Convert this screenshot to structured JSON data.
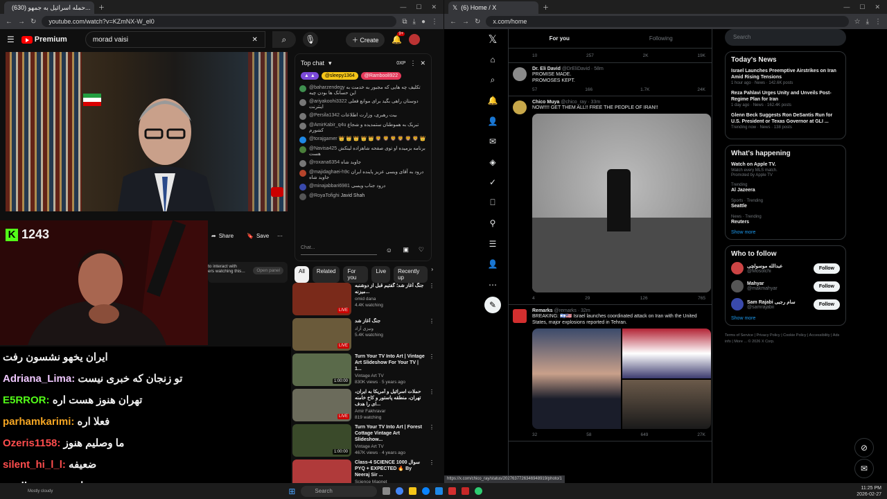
{
  "yt": {
    "tab_title": "(630) حمله اسرائیل به جمهو...",
    "url": "youtube.com/watch?v=KZmNX-W_el0",
    "logo": "Premium",
    "search": "morad vaisi",
    "create": "Create",
    "notif_count": "9+",
    "share": "Share",
    "save": "Save",
    "sign_in_text": "to interact with",
    "sign_in_text2": "ers watching this...",
    "open_panel": "Open panel",
    "livechat": {
      "title": "Top chat",
      "xp": "0XP",
      "pills": [
        "@sleepy1364",
        "@Rambooli922"
      ],
      "messages": [
        {
          "user": "@baharzendegy",
          "text": "تکلیف چه هایی که مجبور به خدمت به این حسانک ها بودن چیه",
          "color": "#3f8f4f"
        },
        {
          "user": "@ariyakoohi3322",
          "text": "دوستان راهی بگید برای موانع فعلی اینترنت",
          "color": "#777"
        },
        {
          "user": "@Persila1342",
          "text": "بیت رهبری، وزارت اطلاعات",
          "color": "#777"
        },
        {
          "user": "@AmirKabir_q4u",
          "text": "تبریک به هموطنان ستمدیده و شجاع کشورم",
          "color": "#777"
        },
        {
          "user": "@torajgamer",
          "text": "👑 👑 👑 👑 👑 🦁 🦁 🦁 🦁 🦁 🦁 👑",
          "color": "#1e88e5"
        },
        {
          "user": "@Navisa425",
          "text": "برنامه بزمیده او توی صفحه شاهزاده لینکش هست",
          "color": "#4a7f3a"
        },
        {
          "user": "@roxana6354",
          "text": "جاوید شاه",
          "color": "#777"
        },
        {
          "user": "@majidaghaei-h9c",
          "text": "درود به آقای ویسی عزیز پاینده ایران جاوید شاه",
          "color": "#b5442b"
        },
        {
          "user": "@minajabbari6981",
          "text": "درود جناب ویسی",
          "color": "#3949ab"
        },
        {
          "user": "@RoyaTofighi",
          "text": "Javid Shah",
          "color": "#555"
        }
      ],
      "input": "Chat..."
    },
    "filters": [
      "All",
      "Related",
      "For you",
      "Live",
      "Recently up"
    ],
    "recs": [
      {
        "title": "جنگ آغاز شد؛ گفتیم قبل از دوشنبه میزنه...",
        "channel": "omid dana",
        "meta": "4.4K watching",
        "badge": "LIVE",
        "thumb": "#7a2a1a"
      },
      {
        "title": "جنگ آغاز شد",
        "channel": "ونیزی آزاد",
        "meta": "5.4K watching",
        "badge": "LIVE",
        "thumb": "#6a5a3a"
      },
      {
        "title": "Turn Your TV Into Art | Vintage Art Slideshow For Your TV | 1...",
        "channel": "Vintage Art TV",
        "meta": "830K views · 5 years ago",
        "badge": "1:00:00",
        "thumb": "#5a6a4a"
      },
      {
        "title": "حملات اسرائیل و آمریکا به ایران، تهران، منطقه پاستور و کاخ خامنه ای را هدف...",
        "channel": "Amir Fakhravar",
        "meta": "819 watching",
        "badge": "LIVE",
        "thumb": "#6b6b5b"
      },
      {
        "title": "Turn Your TV Into Art | Forest Cottage Vintage Art Slideshow...",
        "channel": "Vintage Art TV",
        "meta": "467K views · 4 years ago",
        "badge": "1:00:00",
        "thumb": "#3a4a2a"
      },
      {
        "title": "Class-4 SCIENCE 1000 سوال PYQ + EXPECTED 🔥 By Neeraj Sir ...",
        "channel": "Science Magnet",
        "meta": "",
        "badge": "",
        "thumb": "#b03a3a"
      }
    ]
  },
  "stream": {
    "viewers": "1243",
    "chat": [
      {
        "user": "",
        "text": "ایران یخهو نشسون رفت",
        "color": "#ffffff"
      },
      {
        "user": "Adriana_Lima:",
        "text": "تو زنجان که خبری نیست",
        "color": "#f0c8ff"
      },
      {
        "user": "E5RROR:",
        "text": "تهران هنوز هست اره",
        "color": "#53fc18"
      },
      {
        "user": "parhamkarimi:",
        "text": "فعلا اره",
        "color": "#f5a623"
      },
      {
        "user": "Ozeris1158:",
        "text": "ما وصلیم هنوز",
        "color": "#ff4d4d"
      },
      {
        "user": "silent_hi_l_l:",
        "text": "ضعیفه",
        "color": "#ff4d4d"
      },
      {
        "user": "madbery:",
        "text": "ضعیفه اینترنت",
        "color": "#ffffff"
      }
    ]
  },
  "x": {
    "tab_title": "(6) Home / X",
    "url": "x.com/home",
    "tabs": [
      "For you",
      "Following"
    ],
    "tweets": [
      {
        "name": "Dr. Eli David",
        "handle": "@DrEliDavid · 58m",
        "text": "PROMISE MADE.\nPROMOSES KEPT.",
        "stats": [
          "57",
          "166",
          "1.7K",
          "24K"
        ],
        "avatar": "#8a8a8a"
      },
      {
        "name": "Chico Muya",
        "handle": "@chico_ray · 33m",
        "text": "NOW!!!! GET THEM ALL!!  FREE THE PEOPLE OF IRAN!!",
        "stats": [
          "4",
          "29",
          "126",
          "765"
        ],
        "avatar": "#c8a84a"
      },
      {
        "name": "Remarks",
        "handle": "@remarks · 32m",
        "text": "BREAKING: 🇮🇱🇺🇸 Israel launches coordinated attack on Iran with the United States, major explosions reported in Tehran.",
        "stats": [
          "32",
          "58",
          "649",
          "27K"
        ],
        "avatar": "#d32f2f"
      }
    ],
    "top_stats": [
      "10",
      "257",
      "2K",
      "19K"
    ],
    "search": "Search",
    "news_title": "Today's News",
    "news": [
      {
        "title": "Israel Launches Preemptive Airstrikes on Iran Amid Rising Tensions",
        "meta": "1 hour ago · News · 142.6K posts"
      },
      {
        "title": "Reza Pahlavi Urges Unity and Unveils Post-Regime Plan for Iran",
        "meta": "1 day ago · News · 162.4K posts"
      },
      {
        "title": "Glenn Beck Suggests Ron DeSantis Run for U.S. President or Texas Governor at GLI ...",
        "meta": "Trending now · News · 138 posts"
      }
    ],
    "happening_title": "What's happening",
    "happening": [
      {
        "cat": "",
        "title": "Watch on Apple TV.",
        "sub": "Watch every MLS match.\nPromoted by Apple TV"
      },
      {
        "cat": "Trending",
        "title": "Al Jazeera",
        "sub": ""
      },
      {
        "cat": "Sports · Trending",
        "title": "Seattle",
        "sub": ""
      },
      {
        "cat": "News · Trending",
        "title": "Reuters",
        "sub": ""
      }
    ],
    "show_more": "Show more",
    "follow_title": "Who to follow",
    "follow": [
      {
        "name": "عبدالله موسولچی",
        "handle": "@Mosolchi",
        "avatar": "#c44"
      },
      {
        "name": "Mahyar",
        "handle": "@makmahyar",
        "avatar": "#555"
      },
      {
        "name": "Sam Rajabi سام رجبی",
        "handle": "@samrajabii",
        "avatar": "#3949ab"
      }
    ],
    "follow_btn": "Follow",
    "footer": "Terms of Service | Privacy Policy | Cookie Policy | Accessibility | Ads info | More ... © 2026 X Corp.",
    "status_url": "https://x.com/chico_ray/status/2027637726346948919/photo/1"
  },
  "taskbar": {
    "weather": "Mostly cloudy",
    "search": "Search",
    "time": "11:25 PM",
    "date": "2026-02-27"
  }
}
